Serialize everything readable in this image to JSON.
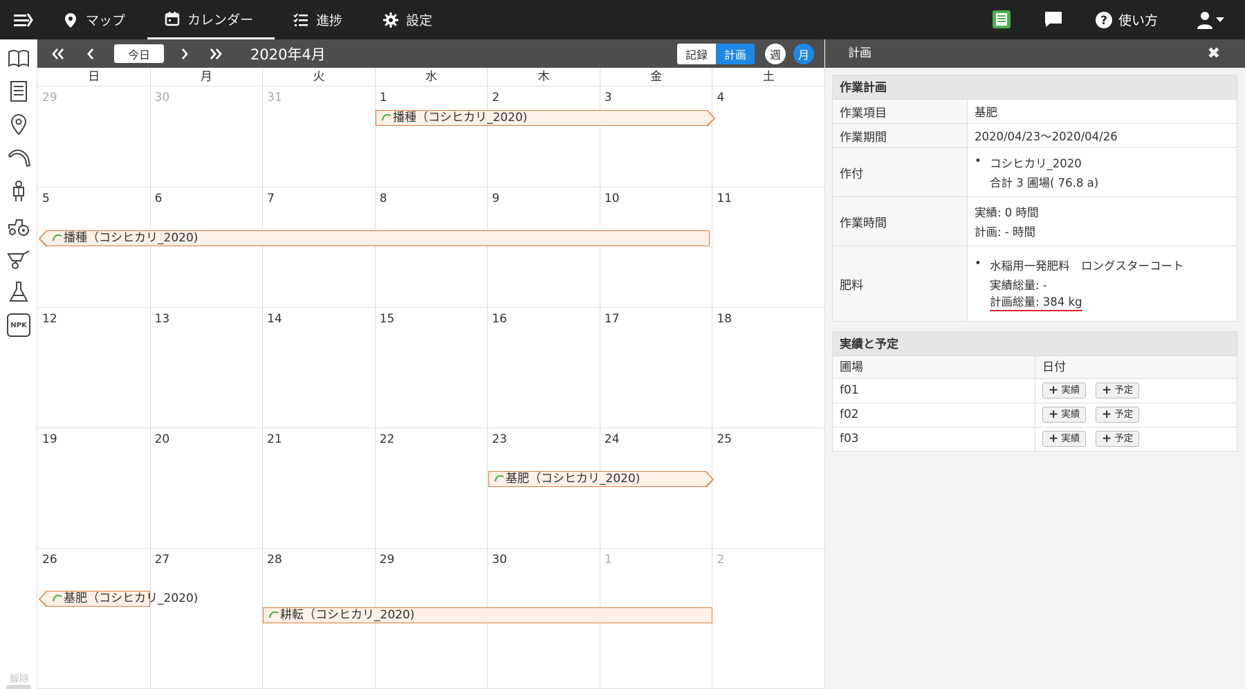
{
  "nav": {
    "items": [
      {
        "label": "マップ",
        "icon": "map-pin-icon"
      },
      {
        "label": "カレンダー",
        "icon": "calendar-icon"
      },
      {
        "label": "進捗",
        "icon": "checklist-icon"
      },
      {
        "label": "設定",
        "icon": "gear-icon"
      }
    ],
    "help_label": "使い方"
  },
  "sidebar": {
    "icons": [
      "book-icon",
      "document-icon",
      "location-icon",
      "sickle-icon",
      "worker-icon",
      "tractor-icon",
      "wheelbarrow-icon",
      "flask-icon",
      "fertilizer-bag-icon"
    ],
    "npk_label": "NPK",
    "filter_label": "解除"
  },
  "calendar": {
    "today_label": "今日",
    "title": "2020年4月",
    "mode_record": "記録",
    "mode_plan": "計画",
    "view_week": "週",
    "view_month": "月",
    "weekdays": [
      "日",
      "月",
      "火",
      "水",
      "木",
      "金",
      "土"
    ],
    "weeks": [
      [
        {
          "d": "29",
          "dim": true
        },
        {
          "d": "30",
          "dim": true
        },
        {
          "d": "31",
          "dim": true
        },
        {
          "d": "1"
        },
        {
          "d": "2"
        },
        {
          "d": "3"
        },
        {
          "d": "4"
        }
      ],
      [
        {
          "d": "5"
        },
        {
          "d": "6"
        },
        {
          "d": "7"
        },
        {
          "d": "8"
        },
        {
          "d": "9"
        },
        {
          "d": "10"
        },
        {
          "d": "11"
        }
      ],
      [
        {
          "d": "12"
        },
        {
          "d": "13"
        },
        {
          "d": "14"
        },
        {
          "d": "15"
        },
        {
          "d": "16"
        },
        {
          "d": "17"
        },
        {
          "d": "18"
        }
      ],
      [
        {
          "d": "19"
        },
        {
          "d": "20"
        },
        {
          "d": "21"
        },
        {
          "d": "22"
        },
        {
          "d": "23"
        },
        {
          "d": "24"
        },
        {
          "d": "25"
        }
      ],
      [
        {
          "d": "26"
        },
        {
          "d": "27"
        },
        {
          "d": "28"
        },
        {
          "d": "29"
        },
        {
          "d": "30"
        },
        {
          "d": "1",
          "dim": true
        },
        {
          "d": "2",
          "dim": true
        }
      ]
    ],
    "events": [
      {
        "label": "播種（コシヒカリ_2020)"
      },
      {
        "label": "播種（コシヒカリ_2020)"
      },
      {
        "label": "基肥（コシヒカリ_2020)"
      },
      {
        "label": "基肥（コシヒカリ_2020)"
      },
      {
        "label": "耕転（コシヒカリ_2020)"
      }
    ]
  },
  "panel": {
    "title": "計画",
    "plan_section": "作業計画",
    "rows": {
      "item_key": "作業項目",
      "item_val": "基肥",
      "period_key": "作業期間",
      "period_val": "2020/04/23～2020/04/26",
      "crop_key": "作付",
      "crop_val": "コシヒカリ_2020",
      "crop_sub": "合計 3 圃場( 76.8 a)",
      "time_key": "作業時間",
      "time_actual": "実績: 0 時間",
      "time_plan": "計画: - 時間",
      "fert_key": "肥料",
      "fert_val": "水稲用一発肥料　ロングスターコート",
      "fert_actual": "実績総量: -",
      "fert_plan": "計画総量: 384 kg"
    },
    "schedule_section": "実績と予定",
    "table_head": [
      "圃場",
      "日付"
    ],
    "fields": [
      "f01",
      "f02",
      "f03"
    ],
    "btn_actual": "実績",
    "btn_plan": "予定"
  },
  "colors": {
    "topbar": "#222222",
    "toolbar": "#4d4d4d",
    "accent_blue": "#1e88e5",
    "event_border": "#e07a3c",
    "event_fill": "#fdf0e6",
    "sprout_green": "#4caf50"
  }
}
